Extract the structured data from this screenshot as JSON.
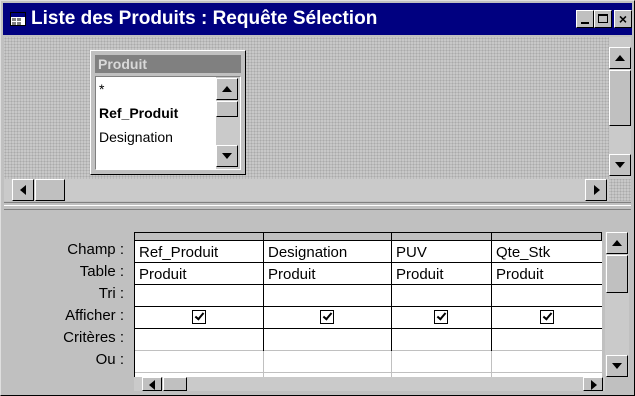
{
  "window": {
    "title": "Liste des Produits : Requête Sélection",
    "controls": {
      "minimize": "_",
      "maximize": "□",
      "close": "×"
    },
    "icon": "query-design-icon"
  },
  "table_box": {
    "title": "Produit",
    "fields": [
      "*",
      "Ref_Produit",
      "Designation"
    ]
  },
  "grid": {
    "row_labels": [
      "Champ :",
      "Table :",
      "Tri :",
      "Afficher :",
      "Critères :",
      "Ou :"
    ],
    "columns": [
      {
        "champ": "Ref_Produit",
        "table": "Produit",
        "tri": "",
        "afficher": true,
        "criteres": "",
        "ou": ""
      },
      {
        "champ": "Designation",
        "table": "Produit",
        "tri": "",
        "afficher": true,
        "criteres": "",
        "ou": ""
      },
      {
        "champ": "PUV",
        "table": "Produit",
        "tri": "",
        "afficher": true,
        "criteres": "",
        "ou": ""
      },
      {
        "champ": "Qte_Stk",
        "table": "Produit",
        "tri": "",
        "afficher": true,
        "criteres": "",
        "ou": ""
      }
    ]
  },
  "colors": {
    "titlebar": "#000080",
    "face": "#c0c0c0",
    "table_title_inactive": "#808080"
  }
}
